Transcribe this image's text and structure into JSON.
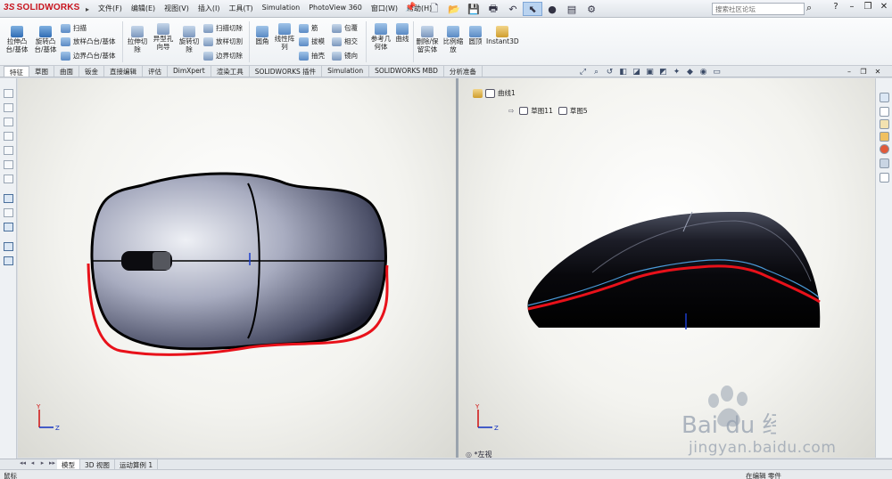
{
  "app": {
    "logo_text": "SOLIDWORKS",
    "menu": [
      "文件(F)",
      "编辑(E)",
      "视图(V)",
      "插入(I)",
      "工具(T)",
      "Simulation",
      "PhotoView 360",
      "窗口(W)",
      "帮助(H)"
    ],
    "search_placeholder": "搜索社区论坛"
  },
  "ribbon": {
    "extrude_boss": "拉伸凸\n台/基体",
    "revolve_boss": "旋转凸\n台/基体",
    "sweep": "扫描",
    "loft": "放样凸台/基体",
    "boundary": "边界凸台/基体",
    "extrude_cut": "拉伸切\n除",
    "hole_wizard": "异型孔\n向导",
    "revolve_cut": "旋转切\n除",
    "sweep_cut": "扫描切除",
    "loft_cut": "放样切割",
    "boundary_cut": "边界切除",
    "fillet": "圆角",
    "linear_pattern": "线性阵\n列",
    "rib": "筋",
    "draft": "拔模",
    "shell": "抽壳",
    "wrap": "包覆",
    "intersect": "相交",
    "mirror": "镜向",
    "ref_geometry": "参考几\n何体",
    "curves": "曲线",
    "delete_body": "删除/保\n留实体",
    "scale": "比例缩\n放",
    "dome": "圆顶",
    "instant3d": "Instant3D"
  },
  "tabs": [
    "特征",
    "草图",
    "曲面",
    "钣金",
    "直接编辑",
    "评估",
    "DimXpert",
    "渲染工具",
    "SOLIDWORKS 插件",
    "Simulation",
    "SOLIDWORKS MBD",
    "分析准备"
  ],
  "active_tab": 0,
  "feature_tree": {
    "curve_item": "曲线1",
    "sketches": [
      "草图11",
      "草图5"
    ]
  },
  "view_label": "*左视",
  "triad_axes": {
    "y": "Y",
    "z": "Z"
  },
  "bottom_tabs": [
    "模型",
    "3D 视图",
    "运动算例 1"
  ],
  "active_bottom_tab": 0,
  "status": {
    "left": "鼠标",
    "right": "在编辑 零件"
  },
  "watermark": {
    "logo": "Bai du 经验",
    "url": "jingyan.baidu.com"
  },
  "colors": {
    "curve_red": "#e8111a",
    "curve_blue": "#4a9ad8"
  }
}
